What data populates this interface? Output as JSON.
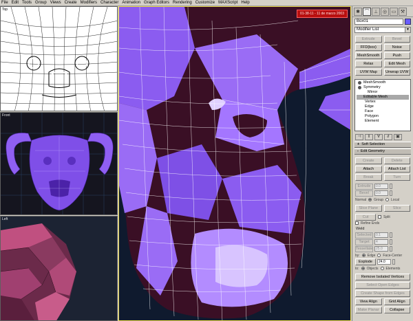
{
  "menu": [
    "File",
    "Edit",
    "Tools",
    "Group",
    "Views",
    "Create",
    "Modifiers",
    "Character",
    "Animation",
    "Graph Editors",
    "Rendering",
    "Customize",
    "MAXScript",
    "Help"
  ],
  "viewports": {
    "top": "Top",
    "front": "Front",
    "left": "Left",
    "date_stamp": "01-38-11 - 11 de marzo 2003"
  },
  "panel": {
    "tab_icons": [
      "create-icon",
      "modify-icon",
      "hierarchy-icon",
      "motion-icon",
      "display-icon",
      "utilities-icon"
    ],
    "object_name": "Box01",
    "object_color": "#6a5cff",
    "modifier_list": "Modifier List",
    "modifier_buttons": [
      "Extrude",
      "Bevel",
      "FFD(box)",
      "Noise",
      "MeshSmooth",
      "Push",
      "Relax",
      "Edit Mesh",
      "UVW Map",
      "Unwrap UVW"
    ],
    "stack": {
      "meshsmooth": "MeshSmooth",
      "symmetry": "Symmetry",
      "mirror": "Mirror",
      "editable_mesh": "Editable Mesh",
      "vertex": "Vertex",
      "edge": "Edge",
      "face": "Face",
      "polygon": "Polygon",
      "element": "Element"
    },
    "rollouts": {
      "soft_selection": "Soft Selection",
      "edit_geometry": "Edit Geometry",
      "plus": "+",
      "minus": "-"
    },
    "edit_geometry": {
      "create": "Create",
      "delete": "Delete",
      "attach": "Attach",
      "attach_list": "Attach List",
      "break": "Break",
      "turn": "Turn",
      "extrude": "Extrude",
      "extrude_val": "0.0",
      "bevel": "Bevel",
      "bevel_val": "0.0",
      "normal": "Normal",
      "group": "Group",
      "local": "Local",
      "slice_plane": "Slice Plane",
      "slice": "Slice",
      "cut": "Cut",
      "split": "Split",
      "refine_ends": "Refine Ends",
      "weld": "Weld",
      "selected": "Selected",
      "selected_val": "0.1",
      "target": "Target",
      "target_val": "4",
      "tessellate": "Tessellate",
      "tessellate_val": "25.0",
      "by": "by:",
      "edge_opt": "Edge",
      "face_center": "Face-Center",
      "explode": "Explode",
      "explode_val": "24.0",
      "to": "to:",
      "objects": "Objects",
      "elements": "Elements",
      "remove_isolated": "Remove Isolated Vertices",
      "select_open_edges": "Select Open Edges",
      "create_shape": "Create Shape from Edges",
      "view_align": "View Align",
      "grid_align": "Grid Align",
      "make_planar": "Make Planar",
      "collapse": "Collapse"
    }
  },
  "colors": {
    "mesh_purple": "#8b5cf0",
    "mesh_shadow": "#3a0f25",
    "wire": "#ffffff",
    "active_border": "#e8d84a"
  }
}
